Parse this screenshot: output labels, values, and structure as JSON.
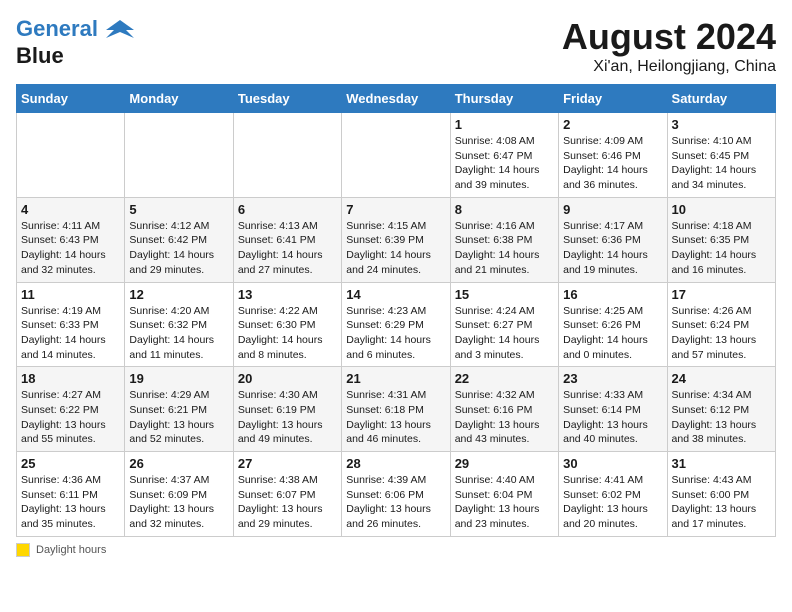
{
  "header": {
    "logo_line1": "General",
    "logo_line2": "Blue",
    "month_year": "August 2024",
    "location": "Xi'an, Heilongjiang, China"
  },
  "days_of_week": [
    "Sunday",
    "Monday",
    "Tuesday",
    "Wednesday",
    "Thursday",
    "Friday",
    "Saturday"
  ],
  "weeks": [
    [
      {
        "day": "",
        "info": ""
      },
      {
        "day": "",
        "info": ""
      },
      {
        "day": "",
        "info": ""
      },
      {
        "day": "",
        "info": ""
      },
      {
        "day": "1",
        "info": "Sunrise: 4:08 AM\nSunset: 6:47 PM\nDaylight: 14 hours and 39 minutes."
      },
      {
        "day": "2",
        "info": "Sunrise: 4:09 AM\nSunset: 6:46 PM\nDaylight: 14 hours and 36 minutes."
      },
      {
        "day": "3",
        "info": "Sunrise: 4:10 AM\nSunset: 6:45 PM\nDaylight: 14 hours and 34 minutes."
      }
    ],
    [
      {
        "day": "4",
        "info": "Sunrise: 4:11 AM\nSunset: 6:43 PM\nDaylight: 14 hours and 32 minutes."
      },
      {
        "day": "5",
        "info": "Sunrise: 4:12 AM\nSunset: 6:42 PM\nDaylight: 14 hours and 29 minutes."
      },
      {
        "day": "6",
        "info": "Sunrise: 4:13 AM\nSunset: 6:41 PM\nDaylight: 14 hours and 27 minutes."
      },
      {
        "day": "7",
        "info": "Sunrise: 4:15 AM\nSunset: 6:39 PM\nDaylight: 14 hours and 24 minutes."
      },
      {
        "day": "8",
        "info": "Sunrise: 4:16 AM\nSunset: 6:38 PM\nDaylight: 14 hours and 21 minutes."
      },
      {
        "day": "9",
        "info": "Sunrise: 4:17 AM\nSunset: 6:36 PM\nDaylight: 14 hours and 19 minutes."
      },
      {
        "day": "10",
        "info": "Sunrise: 4:18 AM\nSunset: 6:35 PM\nDaylight: 14 hours and 16 minutes."
      }
    ],
    [
      {
        "day": "11",
        "info": "Sunrise: 4:19 AM\nSunset: 6:33 PM\nDaylight: 14 hours and 14 minutes."
      },
      {
        "day": "12",
        "info": "Sunrise: 4:20 AM\nSunset: 6:32 PM\nDaylight: 14 hours and 11 minutes."
      },
      {
        "day": "13",
        "info": "Sunrise: 4:22 AM\nSunset: 6:30 PM\nDaylight: 14 hours and 8 minutes."
      },
      {
        "day": "14",
        "info": "Sunrise: 4:23 AM\nSunset: 6:29 PM\nDaylight: 14 hours and 6 minutes."
      },
      {
        "day": "15",
        "info": "Sunrise: 4:24 AM\nSunset: 6:27 PM\nDaylight: 14 hours and 3 minutes."
      },
      {
        "day": "16",
        "info": "Sunrise: 4:25 AM\nSunset: 6:26 PM\nDaylight: 14 hours and 0 minutes."
      },
      {
        "day": "17",
        "info": "Sunrise: 4:26 AM\nSunset: 6:24 PM\nDaylight: 13 hours and 57 minutes."
      }
    ],
    [
      {
        "day": "18",
        "info": "Sunrise: 4:27 AM\nSunset: 6:22 PM\nDaylight: 13 hours and 55 minutes."
      },
      {
        "day": "19",
        "info": "Sunrise: 4:29 AM\nSunset: 6:21 PM\nDaylight: 13 hours and 52 minutes."
      },
      {
        "day": "20",
        "info": "Sunrise: 4:30 AM\nSunset: 6:19 PM\nDaylight: 13 hours and 49 minutes."
      },
      {
        "day": "21",
        "info": "Sunrise: 4:31 AM\nSunset: 6:18 PM\nDaylight: 13 hours and 46 minutes."
      },
      {
        "day": "22",
        "info": "Sunrise: 4:32 AM\nSunset: 6:16 PM\nDaylight: 13 hours and 43 minutes."
      },
      {
        "day": "23",
        "info": "Sunrise: 4:33 AM\nSunset: 6:14 PM\nDaylight: 13 hours and 40 minutes."
      },
      {
        "day": "24",
        "info": "Sunrise: 4:34 AM\nSunset: 6:12 PM\nDaylight: 13 hours and 38 minutes."
      }
    ],
    [
      {
        "day": "25",
        "info": "Sunrise: 4:36 AM\nSunset: 6:11 PM\nDaylight: 13 hours and 35 minutes."
      },
      {
        "day": "26",
        "info": "Sunrise: 4:37 AM\nSunset: 6:09 PM\nDaylight: 13 hours and 32 minutes."
      },
      {
        "day": "27",
        "info": "Sunrise: 4:38 AM\nSunset: 6:07 PM\nDaylight: 13 hours and 29 minutes."
      },
      {
        "day": "28",
        "info": "Sunrise: 4:39 AM\nSunset: 6:06 PM\nDaylight: 13 hours and 26 minutes."
      },
      {
        "day": "29",
        "info": "Sunrise: 4:40 AM\nSunset: 6:04 PM\nDaylight: 13 hours and 23 minutes."
      },
      {
        "day": "30",
        "info": "Sunrise: 4:41 AM\nSunset: 6:02 PM\nDaylight: 13 hours and 20 minutes."
      },
      {
        "day": "31",
        "info": "Sunrise: 4:43 AM\nSunset: 6:00 PM\nDaylight: 13 hours and 17 minutes."
      }
    ]
  ],
  "legend": {
    "label": "Daylight hours"
  }
}
